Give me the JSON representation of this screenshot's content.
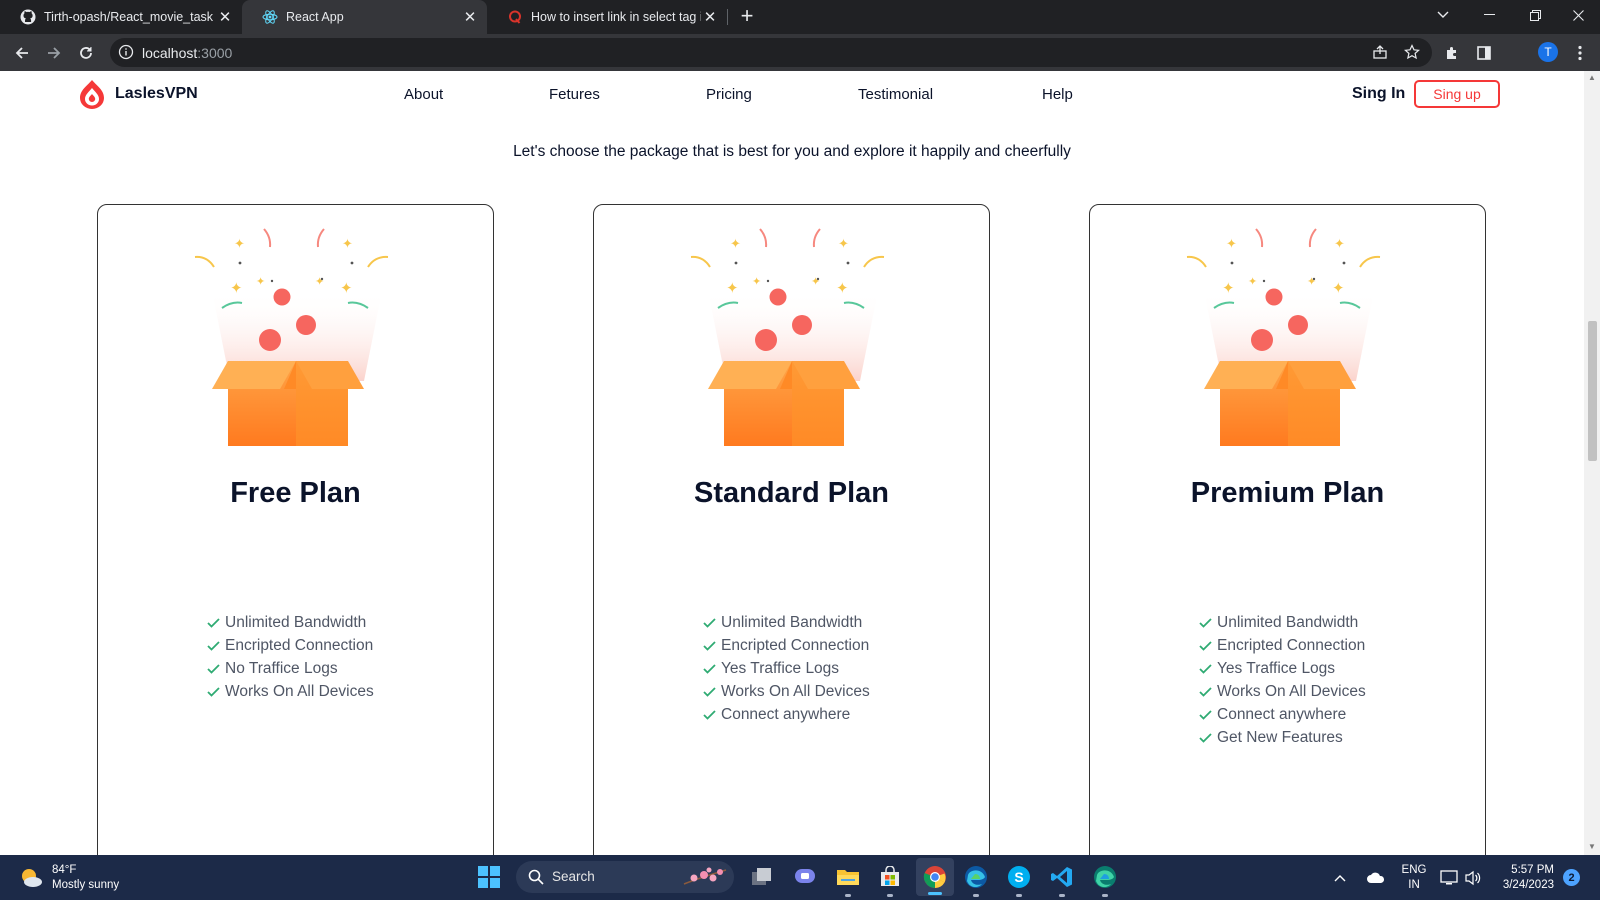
{
  "browser": {
    "tabs": [
      {
        "title": "Tirth-opash/React_movie_task",
        "icon": "github-icon"
      },
      {
        "title": "React App",
        "icon": "react-icon"
      },
      {
        "title": "How to insert link in select tag in",
        "icon": "quora-icon"
      }
    ],
    "url_host": "localhost",
    "url_port": ":3000",
    "profile_initial": "T"
  },
  "site": {
    "logo": "LaslesVPN",
    "nav": [
      "About",
      "Fetures",
      "Pricing",
      "Testimonial",
      "Help"
    ],
    "signin": "Sing In",
    "signup": "Sing up",
    "brand_color": "#f53838",
    "check_color": "#2fab73"
  },
  "pricing": {
    "subtitle": "Let's choose the package that is best for you and explore it happily and cheerfully",
    "plans": [
      {
        "name": "Free Plan",
        "features": [
          "Unlimited Bandwidth",
          "Encripted Connection",
          "No Traffice Logs",
          "Works On All Devices"
        ]
      },
      {
        "name": "Standard Plan",
        "features": [
          "Unlimited Bandwidth",
          "Encripted Connection",
          "Yes Traffice Logs",
          "Works On All Devices",
          "Connect anywhere"
        ]
      },
      {
        "name": "Premium Plan",
        "features": [
          "Unlimited Bandwidth",
          "Encripted Connection",
          "Yes Traffice Logs",
          "Works On All Devices",
          "Connect anywhere",
          "Get New Features"
        ]
      }
    ]
  },
  "taskbar": {
    "weather_temp": "84°F",
    "weather_desc": "Mostly sunny",
    "search_label": "Search",
    "lang": "ENG",
    "region": "IN",
    "time": "5:57 PM",
    "date": "3/24/2023",
    "notifications": "2"
  }
}
